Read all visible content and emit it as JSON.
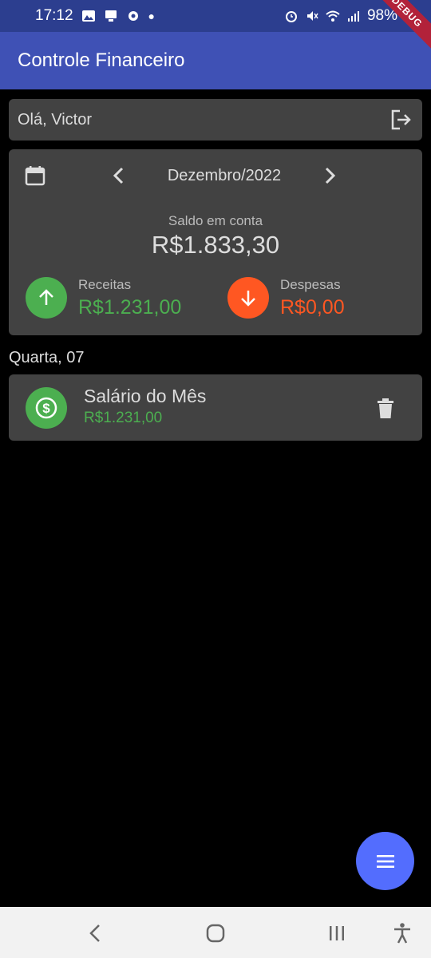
{
  "status_bar": {
    "time": "17:12",
    "battery": "98%",
    "left_icons": [
      "image-icon",
      "cast-icon",
      "settings-icon",
      "dot-icon"
    ],
    "right_icons": [
      "alarm-icon",
      "mute-icon",
      "wifi-icon",
      "signal-icon",
      "battery-icon"
    ]
  },
  "debug_banner": "DEBUG",
  "app_bar": {
    "title": "Controle Financeiro"
  },
  "greeting": {
    "text": "Olá, Victor",
    "action_icon": "logout-icon"
  },
  "summary": {
    "month": "Dezembro/2022",
    "balance_label": "Saldo em conta",
    "balance_value": "R$1.833,30",
    "income": {
      "label": "Receitas",
      "value": "R$1.231,00",
      "color": "#4caf50"
    },
    "expense": {
      "label": "Despesas",
      "value": "R$0,00",
      "color": "#ff5722"
    }
  },
  "transactions": {
    "day_header": "Quarta, 07",
    "items": [
      {
        "title": "Salário do Mês",
        "amount": "R$1.231,00",
        "icon": "dollar-icon"
      }
    ]
  },
  "fab": {
    "icon": "menu-icon"
  },
  "nav_bar": {
    "buttons": [
      "back-icon",
      "home-icon",
      "recents-icon",
      "accessibility-icon"
    ]
  },
  "colors": {
    "app_bar": "#3f51b5",
    "status_bar": "#2c3e8f",
    "card": "#424242",
    "fab": "#536dfe"
  }
}
